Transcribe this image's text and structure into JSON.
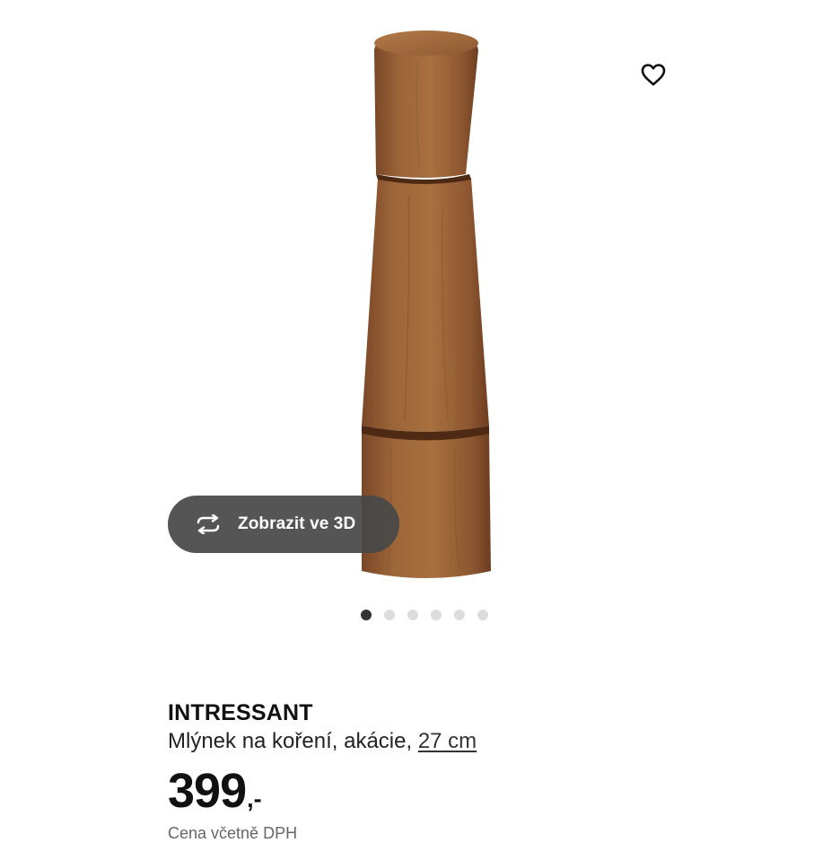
{
  "gallery": {
    "image_alt": "INTRESSANT Mlýnek na koření, akácie",
    "view_3d_label": "Zobrazit ve 3D",
    "total_images": 6,
    "active_image_index": 1
  },
  "product": {
    "name": "INTRESSANT",
    "description": "Mlýnek na koření, akácie,",
    "size": "27 cm",
    "price_amount": "399",
    "price_suffix": ",-",
    "partial_line": "Cena včetně DPH"
  },
  "colors": {
    "wood": "#8a5330",
    "pill_bg": "#484848",
    "dot_active": "#333333",
    "dot_inactive": "#dcdcdc"
  },
  "icons": {
    "favorite": "heart-icon",
    "view_3d": "rotate-icon"
  }
}
